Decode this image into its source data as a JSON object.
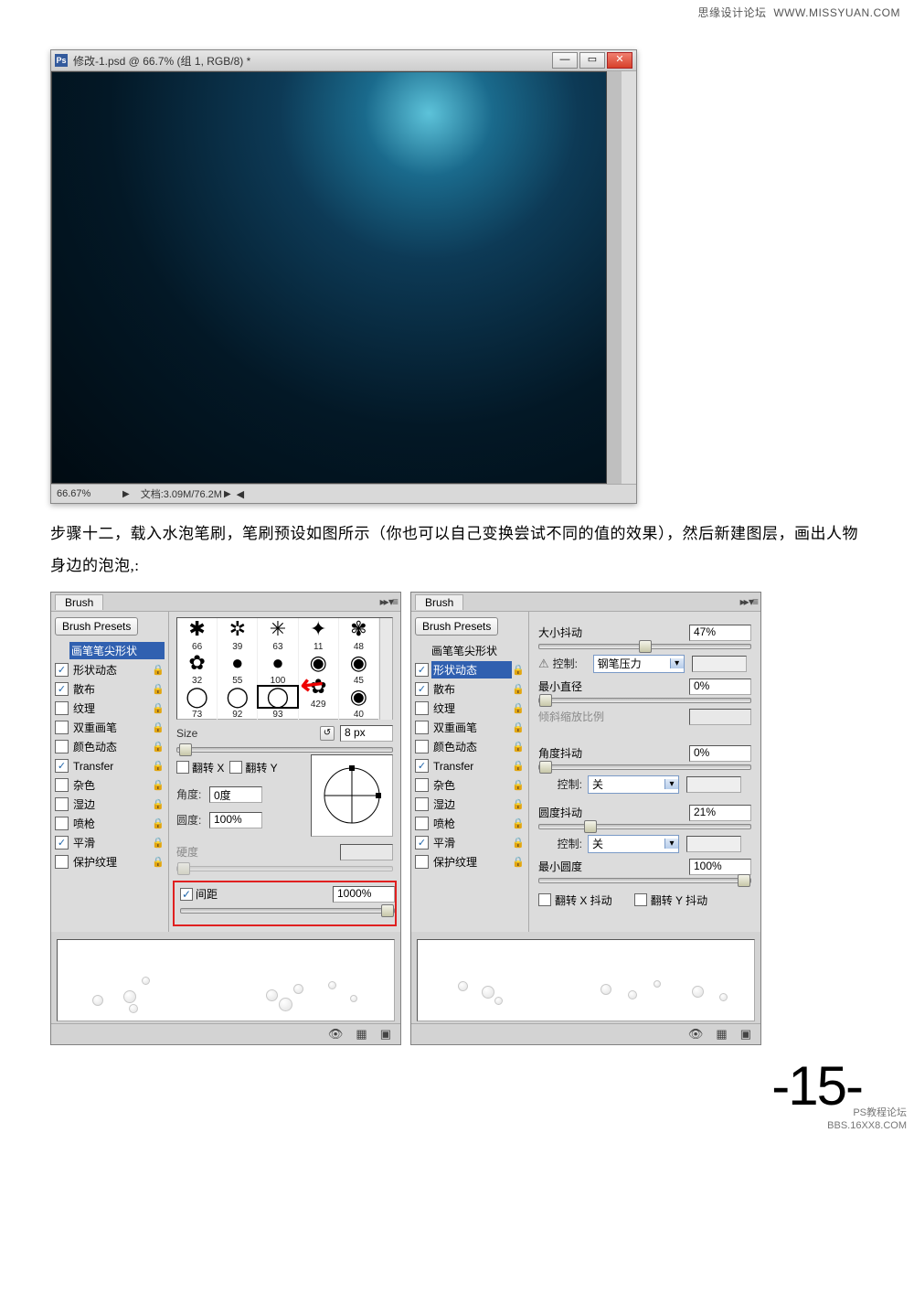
{
  "watermark_top": {
    "cn": "思缘设计论坛",
    "en": "WWW.MISSYUAN.COM"
  },
  "ps_window": {
    "title": "修改-1.psd @ 66.7% (组 1, RGB/8) *",
    "zoom": "66.67%",
    "doc_info": "文档:3.09M/76.2M"
  },
  "paragraph": "步骤十二，载入水泡笔刷，笔刷预设如图所示（你也可以自己变换尝试不同的值的效果），然后新建图层，画出人物身边的泡泡,:",
  "panel_common": {
    "tab": "Brush",
    "presets_btn": "Brush Presets",
    "options": {
      "tip_shape": "画笔笔尖形状",
      "shape_dynamics": "形状动态",
      "scatter": "散布",
      "texture": "纹理",
      "dual_brush": "双重画笔",
      "color_dynamics": "颜色动态",
      "transfer": "Transfer",
      "noise": "杂色",
      "wet_edges": "湿边",
      "airbrush": "喷枪",
      "smoothing": "平滑",
      "protect_texture": "保护纹理"
    }
  },
  "left_panel": {
    "thumb_sizes_r1": [
      "66",
      "39",
      "63",
      "11",
      "48"
    ],
    "thumb_sizes_r2": [
      "32",
      "55",
      "100",
      "",
      "45"
    ],
    "thumb_sizes_r3": [
      "73",
      "92",
      "93",
      "429",
      "40"
    ],
    "size_label": "Size",
    "size_value": "8 px",
    "flip_x": "翻转 X",
    "flip_y": "翻转 Y",
    "angle_label": "角度:",
    "angle_value": "0度",
    "roundness_label": "圆度:",
    "roundness_value": "100%",
    "hardness_label": "硬度",
    "spacing_label": "间距",
    "spacing_value": "1000%"
  },
  "right_panel": {
    "size_jitter_label": "大小抖动",
    "size_jitter_value": "47%",
    "control_label": "控制:",
    "control_pen": "钢笔压力",
    "control_off": "关",
    "min_diameter_label": "最小直径",
    "min_diameter_value": "0%",
    "tilt_scale_label": "倾斜缩放比例",
    "angle_jitter_label": "角度抖动",
    "angle_jitter_value": "0%",
    "roundness_jitter_label": "圆度抖动",
    "roundness_jitter_value": "21%",
    "min_roundness_label": "最小圆度",
    "min_roundness_value": "100%",
    "flip_x_jitter": "翻转 X 抖动",
    "flip_y_jitter": "翻转 Y 抖动"
  },
  "page_number": "-15-",
  "watermark_bottom": {
    "l1": "PS教程论坛",
    "l2": "BBS.16XX8.COM"
  }
}
